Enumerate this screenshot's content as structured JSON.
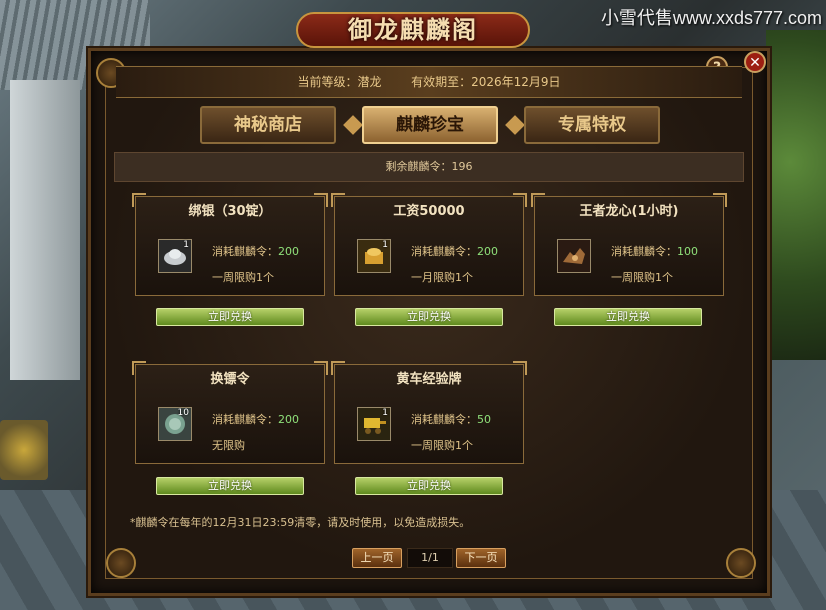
{
  "watermark": "小雪代售www.xxds777.com",
  "window": {
    "title": "御龙麒麟阁",
    "help_label": "?",
    "close_label": "✕"
  },
  "info": {
    "level_label": "当前等级：潜龙",
    "expiry_label": "有效期至：2026年12月9日"
  },
  "tabs": [
    {
      "label": "神秘商店",
      "active": false
    },
    {
      "label": "麒麟珍宝",
      "active": true
    },
    {
      "label": "专属特权",
      "active": false
    }
  ],
  "remaining": "剩余麒麟令：196",
  "items": [
    {
      "name": "绑银（30锭）",
      "count": "1",
      "cost_label": "消耗麒麟令：",
      "cost": "200",
      "limit": "一周限购1个",
      "button": "立即兑换",
      "icon": "silver-ingot-icon"
    },
    {
      "name": "工资50000",
      "count": "1",
      "cost_label": "消耗麒麟令：",
      "cost": "200",
      "limit": "一月限购1个",
      "button": "立即兑换",
      "icon": "wage-chest-icon"
    },
    {
      "name": "王者龙心(1小时)",
      "count": "",
      "cost_label": "消耗麒麟令：",
      "cost": "100",
      "limit": "一周限购1个",
      "button": "立即兑换",
      "icon": "dragon-heart-icon"
    },
    {
      "name": "换镖令",
      "count": "10",
      "cost_label": "消耗麒麟令：",
      "cost": "200",
      "limit": "无限购",
      "button": "立即兑换",
      "icon": "escort-token-icon"
    },
    {
      "name": "黄车经验牌",
      "count": "1",
      "cost_label": "消耗麒麟令：",
      "cost": "50",
      "limit": "一周限购1个",
      "button": "立即兑换",
      "icon": "gold-cart-icon"
    }
  ],
  "notice": "*麒麟令在每年的12月31日23:59清零，请及时使用，以免造成损失。",
  "pager": {
    "prev": "上一页",
    "page": "1/1",
    "next": "下一页"
  }
}
